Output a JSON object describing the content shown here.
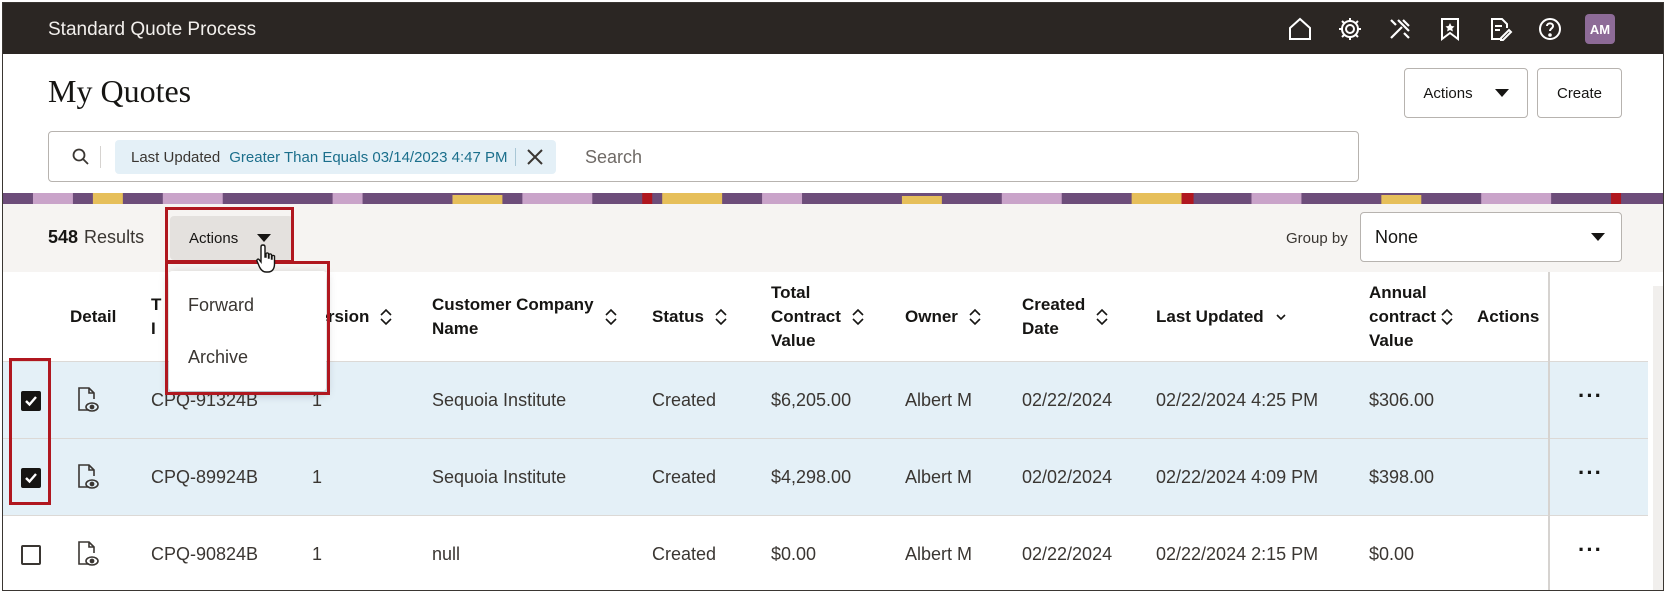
{
  "topbar": {
    "app_title": "Standard Quote Process",
    "icons": [
      "home-icon",
      "gear-icon",
      "tools-icon",
      "bookmark-icon",
      "edit-document-icon",
      "help-icon"
    ],
    "avatar_initials": "AM"
  },
  "header": {
    "page_title": "My Quotes",
    "actions_label": "Actions",
    "create_label": "Create"
  },
  "search": {
    "filter_label": "Last Updated",
    "filter_value": "Greater Than Equals 03/14/2023 4:47 PM",
    "placeholder": "Search"
  },
  "toolbar": {
    "results_count": "548",
    "results_label": "Results",
    "actions_label": "Actions",
    "group_by_label": "Group by",
    "group_by_value": "None"
  },
  "actions_menu": {
    "items": [
      "Forward",
      "Archive"
    ]
  },
  "table": {
    "columns": {
      "detail": "Detail",
      "transaction_id_1": "T",
      "transaction_id_2": "I",
      "version": "Version",
      "customer_1": "Customer Company",
      "customer_2": "Name",
      "status": "Status",
      "tcv_1": "Total",
      "tcv_2": "Contract",
      "tcv_3": "Value",
      "owner": "Owner",
      "created_1": "Created",
      "created_2": "Date",
      "last_updated": "Last Updated",
      "acv_1": "Annual",
      "acv_2": "contract",
      "acv_3": "Value",
      "actions": "Actions"
    },
    "rows": [
      {
        "selected": true,
        "id": "CPQ-91324B",
        "version": "1",
        "customer": "Sequoia Institute",
        "status": "Created",
        "tcv": "$6,205.00",
        "owner": "Albert M",
        "created": "02/22/2024",
        "updated": "02/22/2024 4:25 PM",
        "acv": "$306.00"
      },
      {
        "selected": true,
        "id": "CPQ-89924B",
        "version": "1",
        "customer": "Sequoia Institute",
        "status": "Created",
        "tcv": "$4,298.00",
        "owner": "Albert M",
        "created": "02/02/2024",
        "updated": "02/22/2024 4:09 PM",
        "acv": "$398.00"
      },
      {
        "selected": false,
        "id": "CPQ-90824B",
        "version": "1",
        "customer": "null",
        "status": "Created",
        "tcv": "$0.00",
        "owner": "Albert M",
        "created": "02/22/2024",
        "updated": "02/22/2024 2:15 PM",
        "acv": "$0.00"
      }
    ],
    "row_actions_icon": "more-horizontal-icon",
    "more_glyph": "···"
  },
  "colors": {
    "topbar_bg": "#2b2623",
    "selected_row_bg": "#e4f0f7",
    "chip_value": "#1b6f8c",
    "highlight_border": "#b0171f",
    "avatar_bg": "#8d6b97"
  }
}
